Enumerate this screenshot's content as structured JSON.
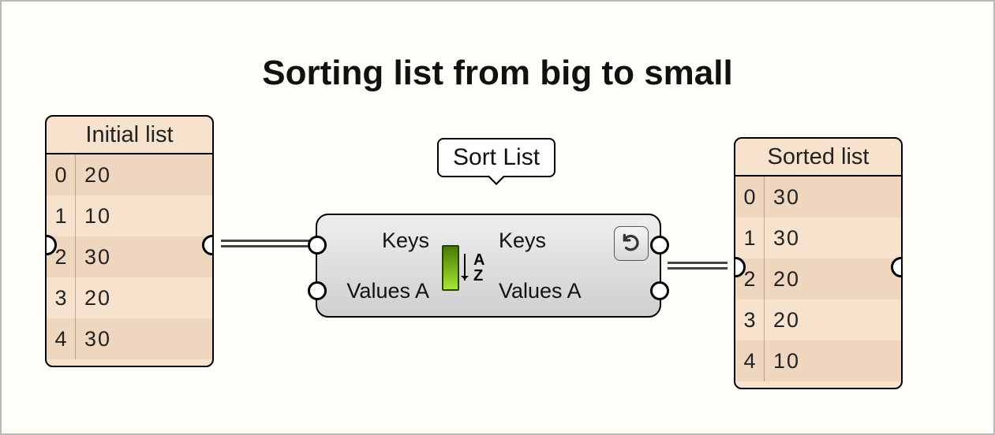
{
  "title": "Sorting list from big to small",
  "tooltip": "Sort List",
  "initial_panel": {
    "header": "Initial list",
    "rows": [
      {
        "index": "0",
        "value": "20"
      },
      {
        "index": "1",
        "value": "10"
      },
      {
        "index": "2",
        "value": "30"
      },
      {
        "index": "3",
        "value": "20"
      },
      {
        "index": "4",
        "value": "30"
      }
    ]
  },
  "sorted_panel": {
    "header": "Sorted list",
    "rows": [
      {
        "index": "0",
        "value": "30"
      },
      {
        "index": "1",
        "value": "30"
      },
      {
        "index": "2",
        "value": "20"
      },
      {
        "index": "3",
        "value": "20"
      },
      {
        "index": "4",
        "value": "10"
      }
    ]
  },
  "component": {
    "inputs": {
      "keys": "Keys",
      "values": "Values A"
    },
    "outputs": {
      "keys": "Keys",
      "values": "Values A"
    },
    "icon_letters": {
      "a": "A",
      "z": "Z"
    }
  }
}
